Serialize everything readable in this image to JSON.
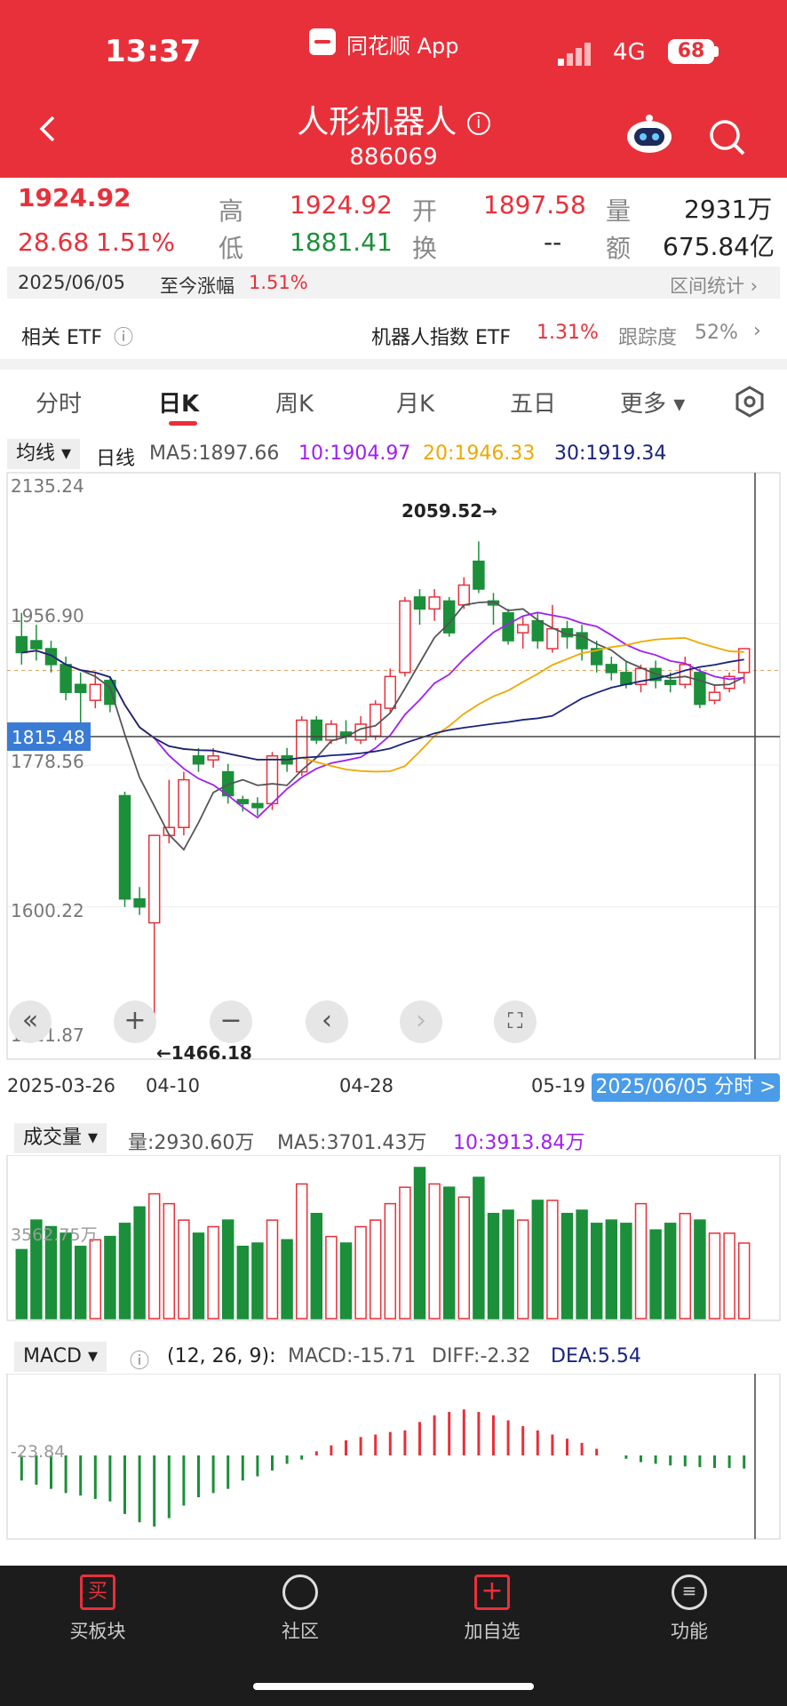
{
  "status_bar": {
    "time": "13:37",
    "app": "同花顺 App",
    "network": "4G",
    "battery": "68"
  },
  "header": {
    "title": "人形机器人",
    "info_icon": "info-icon",
    "code": "886069"
  },
  "quote": {
    "price": "1924.92",
    "change": "28.68",
    "change_pct": "1.51%",
    "high_label": "高",
    "high": "1924.92",
    "low_label": "低",
    "low": "1881.41",
    "open_label": "开",
    "open": "1897.58",
    "turnover_label": "换",
    "turnover": "--",
    "volume_label": "量",
    "volume": "2931万",
    "amount_label": "额",
    "amount": "675.84亿"
  },
  "date_row": {
    "date": "2025/06/05",
    "gain_label": "至今涨幅",
    "gain": "1.51%",
    "stats": "区间统计"
  },
  "etf": {
    "label": "相关 ETF",
    "name": "机器人指数 ETF",
    "pct": "1.31%",
    "track_label": "跟踪度",
    "track": "52%"
  },
  "tabs": [
    "分时",
    "日K",
    "周K",
    "月K",
    "五日",
    "更多"
  ],
  "ma_row": {
    "type": "均线",
    "period": "日线",
    "ma5": "MA5:1897.66",
    "ma10": "10:1904.97",
    "ma20": "20:1946.33",
    "ma30": "30:1919.34"
  },
  "price_axis": {
    "top": "2135.24",
    "p2": "1956.90",
    "cross": "1815.48",
    "p3": "1778.56",
    "p4": "1600.22",
    "bottom": "1421.87",
    "high_mark": "2059.52→",
    "low_mark": "←1466.18"
  },
  "dates": [
    "2025-03-26",
    "04-10",
    "04-28",
    "05-19"
  ],
  "fenshi_btn": "2025/06/05 分时 >",
  "volume_row": {
    "label": "成交量",
    "vol": "量:2930.60万",
    "ma5": "MA5:3701.43万",
    "ma10": "10:3913.84万",
    "axis": "3562.75万"
  },
  "macd_row": {
    "label": "MACD",
    "params": "(12, 26, 9):",
    "macd": "MACD:-15.71",
    "diff": "DIFF:-2.32",
    "dea": "DEA:5.54",
    "axis": "-23.84"
  },
  "bottom_nav": [
    "买板块",
    "社区",
    "加自选",
    "功能"
  ],
  "colors": {
    "up": "#e8303a",
    "down": "#1b8f3a",
    "ma5": "#555555",
    "ma10": "#a020f0",
    "ma20": "#f0a800",
    "ma30": "#1a237e"
  },
  "chart_data": {
    "type": "candlestick",
    "ylim": [
      1421.87,
      2135.24
    ],
    "candles": [
      [
        1940,
        1920,
        1970,
        1905
      ],
      [
        1935,
        1925,
        1955,
        1910
      ],
      [
        1925,
        1905,
        1935,
        1895
      ],
      [
        1905,
        1870,
        1915,
        1860
      ],
      [
        1880,
        1870,
        1895,
        1830
      ],
      [
        1860,
        1880,
        1895,
        1850
      ],
      [
        1885,
        1855,
        1890,
        1845
      ],
      [
        1740,
        1610,
        1745,
        1600
      ],
      [
        1610,
        1600,
        1625,
        1590
      ],
      [
        1580,
        1690,
        1690,
        1465
      ],
      [
        1690,
        1700,
        1760,
        1680
      ],
      [
        1700,
        1760,
        1770,
        1690
      ],
      [
        1790,
        1780,
        1800,
        1770
      ],
      [
        1785,
        1790,
        1800,
        1775
      ],
      [
        1770,
        1740,
        1780,
        1730
      ],
      [
        1735,
        1730,
        1740,
        1720
      ],
      [
        1730,
        1725,
        1738,
        1715
      ],
      [
        1730,
        1790,
        1795,
        1722
      ],
      [
        1790,
        1780,
        1800,
        1770
      ],
      [
        1770,
        1835,
        1840,
        1765
      ],
      [
        1835,
        1810,
        1840,
        1805
      ],
      [
        1810,
        1830,
        1835,
        1805
      ],
      [
        1820,
        1815,
        1835,
        1805
      ],
      [
        1810,
        1830,
        1840,
        1805
      ],
      [
        1815,
        1855,
        1860,
        1810
      ],
      [
        1850,
        1890,
        1900,
        1845
      ],
      [
        1895,
        1985,
        1990,
        1890
      ],
      [
        1990,
        1975,
        2000,
        1955
      ],
      [
        1975,
        1990,
        2000,
        1960
      ],
      [
        1985,
        1945,
        1990,
        1940
      ],
      [
        1980,
        2005,
        2015,
        1975
      ],
      [
        2035,
        2000,
        2060,
        1995
      ],
      [
        1985,
        1980,
        1995,
        1955
      ],
      [
        1970,
        1935,
        1975,
        1930
      ],
      [
        1945,
        1955,
        1965,
        1925
      ],
      [
        1960,
        1935,
        1970,
        1925
      ],
      [
        1925,
        1950,
        1980,
        1920
      ],
      [
        1950,
        1940,
        1960,
        1925
      ],
      [
        1945,
        1925,
        1955,
        1910
      ],
      [
        1925,
        1905,
        1935,
        1895
      ],
      [
        1905,
        1895,
        1915,
        1885
      ],
      [
        1895,
        1880,
        1910,
        1875
      ],
      [
        1880,
        1900,
        1905,
        1870
      ],
      [
        1900,
        1885,
        1910,
        1875
      ],
      [
        1885,
        1880,
        1895,
        1870
      ],
      [
        1880,
        1905,
        1915,
        1875
      ],
      [
        1895,
        1855,
        1900,
        1850
      ],
      [
        1860,
        1870,
        1880,
        1855
      ],
      [
        1875,
        1890,
        1895,
        1870
      ],
      [
        1895,
        1925,
        1925,
        1881
      ]
    ],
    "volumes": [
      2.1,
      3.0,
      2.8,
      2.6,
      2.2,
      2.4,
      2.5,
      2.9,
      3.4,
      3.8,
      3.5,
      3.0,
      2.6,
      2.8,
      3.0,
      2.2,
      2.3,
      3.0,
      2.4,
      4.1,
      3.2,
      2.5,
      2.3,
      2.8,
      3.0,
      3.5,
      4.0,
      4.6,
      4.1,
      4.0,
      3.7,
      4.3,
      3.2,
      3.3,
      3.0,
      3.6,
      3.6,
      3.2,
      3.3,
      2.9,
      3.0,
      2.9,
      3.5,
      2.7,
      2.9,
      3.2,
      3.0,
      2.6,
      2.6,
      2.3
    ],
    "macd": [
      -30,
      -35,
      -40,
      -45,
      -48,
      -52,
      -55,
      -70,
      -80,
      -85,
      -75,
      -60,
      -50,
      -45,
      -40,
      -30,
      -25,
      -18,
      -10,
      -5,
      5,
      12,
      18,
      22,
      25,
      28,
      30,
      40,
      48,
      52,
      55,
      52,
      48,
      42,
      35,
      30,
      25,
      20,
      15,
      8,
      0,
      -4,
      -8,
      -10,
      -12,
      -13,
      -14,
      -15,
      -15,
      -15.71
    ]
  }
}
